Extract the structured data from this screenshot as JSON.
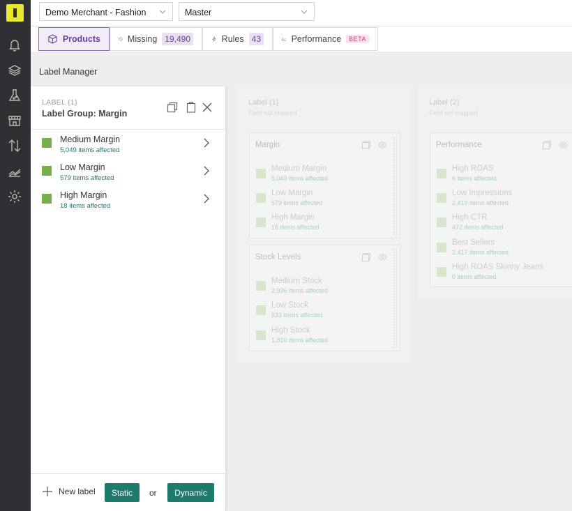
{
  "rail": {
    "icons": [
      "logo-icon",
      "bell-icon",
      "layers-icon",
      "flask-icon",
      "store-icon",
      "sort-arrows-icon",
      "chart-icon",
      "gear-icon"
    ]
  },
  "topbar": {
    "merchant_select": "Demo Merchant - Fashion",
    "branch_select": "Master"
  },
  "tabs": [
    {
      "label": "Products",
      "icon": "box-icon"
    },
    {
      "label": "Missing",
      "badge": "19,490",
      "icon": "ban-icon"
    },
    {
      "label": "Rules",
      "badge": "43",
      "icon": "bolt-icon"
    },
    {
      "label": "Performance",
      "badge": "BETA",
      "icon": "line-chart-icon"
    }
  ],
  "page": {
    "title": "Label Manager"
  },
  "panel": {
    "label": "LABEL (1)",
    "group": "Label Group: Margin",
    "items": [
      {
        "name": "Medium Margin",
        "count": "5,049 items affected"
      },
      {
        "name": "Low Margin",
        "count": "579 items affected"
      },
      {
        "name": "High Margin",
        "count": "18 items affected"
      }
    ],
    "new_label": "New label",
    "static_button": "Static",
    "or": "or",
    "dynamic_button": "Dynamic"
  },
  "columns": [
    {
      "title": "Label (1)",
      "subtitle": "Field not mapped",
      "groups": [
        {
          "name": "Margin",
          "items": [
            {
              "name": "Medium Margin",
              "count": "5,049 items affected"
            },
            {
              "name": "Low Margin",
              "count": "579 items affected"
            },
            {
              "name": "High Margin",
              "count": "18 items affected"
            }
          ]
        },
        {
          "name": "Stock Levels",
          "items": [
            {
              "name": "Medium Stock",
              "count": "2,936 items affected"
            },
            {
              "name": "Low Stock",
              "count": "933 items affected"
            },
            {
              "name": "High Stock",
              "count": "1,810 items affected"
            }
          ]
        }
      ]
    },
    {
      "title": "Label (2)",
      "subtitle": "Field not mapped",
      "groups": [
        {
          "name": "Performance",
          "items": [
            {
              "name": "High ROAS",
              "count": "6 items affected"
            },
            {
              "name": "Low Impressions",
              "count": "2,419 items affected"
            },
            {
              "name": "High CTR",
              "count": "472 items affected"
            },
            {
              "name": "Best Sellers",
              "count": "2,417 items affected"
            },
            {
              "name": "High ROAS Skinny Jeans",
              "count": "0 items affected"
            }
          ]
        }
      ]
    }
  ],
  "colors": {
    "accent": "#6a3f9b",
    "label_green": "#76b04a",
    "button_teal": "#1e7a6c",
    "logo_yellow": "#e8e833"
  }
}
